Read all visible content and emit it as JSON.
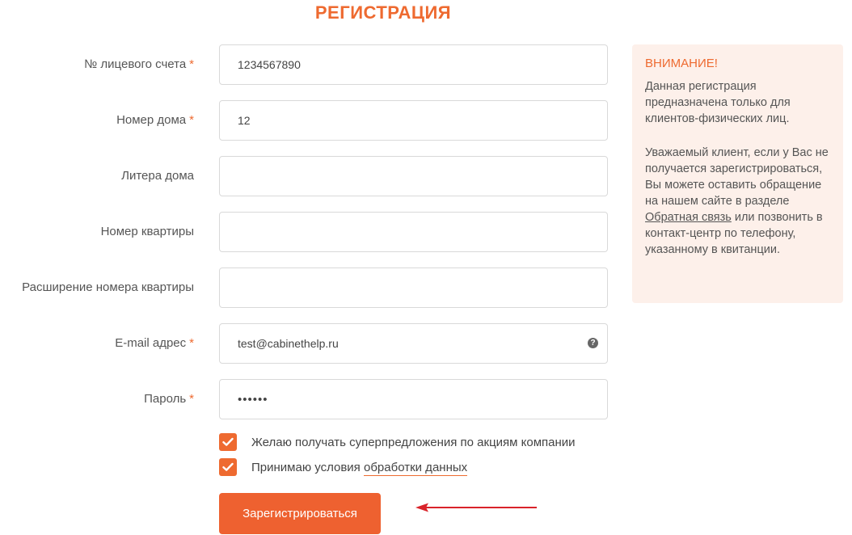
{
  "header": {
    "title": "РЕГИСТРАЦИЯ"
  },
  "form": {
    "fields": [
      {
        "label": "№ лицевого счета",
        "required": "*",
        "value": "1234567890"
      },
      {
        "label": "Номер дома",
        "required": "*",
        "value": "12"
      },
      {
        "label": "Литера дома",
        "required": "",
        "value": ""
      },
      {
        "label": "Номер квартиры",
        "required": "",
        "value": ""
      },
      {
        "label": "Расширение номера квартиры",
        "required": "",
        "value": ""
      },
      {
        "label": "E-mail адрес",
        "required": "*",
        "value": "test@cabinethelp.ru"
      },
      {
        "label": "Пароль",
        "required": "*",
        "value": "••••••"
      }
    ],
    "checkboxes": [
      {
        "text": "Желаю получать суперпредложения по акциям компании",
        "link": "",
        "checked": true
      },
      {
        "text": "Принимаю условия ",
        "link": "обработки данных",
        "checked": true
      }
    ],
    "submit_label": "Зарегистрироваться"
  },
  "notice": {
    "title": "ВНИМАНИЕ!",
    "paragraph1": "Данная регистрация предназначена только для клиентов-физических лиц.",
    "paragraph2_before": "Уважаемый клиент, если у Вас не получается зарегистрироваться, Вы можете оставить обращение на нашем сайте в разделе ",
    "paragraph2_link": "Обратная связь",
    "paragraph2_after": " или позвонить в контакт-центр по телефону, указанному в квитанции."
  },
  "icons": {
    "help": "question-circle-icon",
    "check": "checkmark-icon",
    "arrow": "arrow-left-icon"
  },
  "colors": {
    "accent": "#ee6a30",
    "button": "#ee6130",
    "notice_bg": "#fdf0ea",
    "arrow": "#d9232a"
  }
}
